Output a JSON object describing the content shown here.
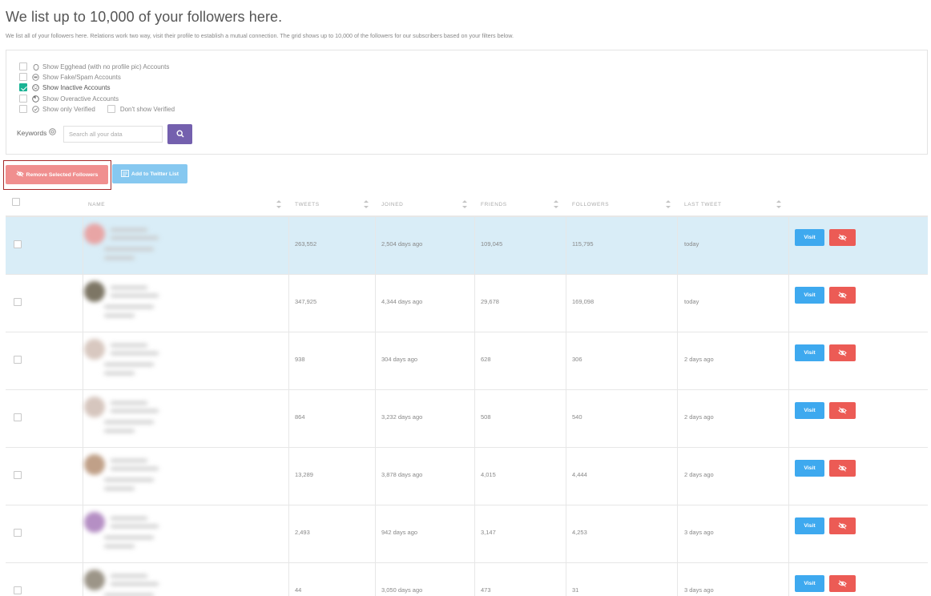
{
  "header": {
    "title": "We list up to 10,000 of your followers here.",
    "description": "We list all of your followers here. Relations work two way, visit their profile to establish a mutual connection. The grid shows up to 10,000 of the followers for our subscribers based on your filters below."
  },
  "filters": {
    "egghead": {
      "label": "Show Egghead (with no profile pic) Accounts",
      "checked": false,
      "icon": "egg-icon"
    },
    "fake": {
      "label": "Show Fake/Spam Accounts",
      "checked": false,
      "icon": "robot-icon"
    },
    "inactive": {
      "label": "Show Inactive Accounts",
      "checked": true,
      "icon": "sleep-face-icon"
    },
    "overactive": {
      "label": "Show Overactive Accounts",
      "checked": false,
      "icon": "speedometer-icon"
    },
    "verified_only": {
      "label": "Show only Verified",
      "checked": false,
      "icon": "verified-icon"
    },
    "hide_verified": {
      "label": "Don't show Verified",
      "checked": false
    }
  },
  "search": {
    "label": "Keywords",
    "placeholder": "Search all your data",
    "button_icon": "search-icon"
  },
  "actions": {
    "remove_label": "Remove Selected Followers",
    "add_list_label": "Add to Twitter List"
  },
  "grid": {
    "columns": [
      "NAME",
      "TWEETS",
      "JOINED",
      "FRIENDS",
      "FOLLOWERS",
      "LAST TWEET"
    ],
    "visit_label": "Visit",
    "rows": [
      {
        "tweets": "263,552",
        "joined": "2,504 days ago",
        "friends": "109,045",
        "followers": "115,795",
        "last_tweet": "today",
        "selected": true,
        "avatar_color": "#e8a5a5"
      },
      {
        "tweets": "347,925",
        "joined": "4,344 days ago",
        "friends": "29,678",
        "followers": "169,098",
        "last_tweet": "today",
        "selected": false,
        "avatar_color": "#7d7665"
      },
      {
        "tweets": "938",
        "joined": "304 days ago",
        "friends": "628",
        "followers": "306",
        "last_tweet": "2 days ago",
        "selected": false,
        "avatar_color": "#d8c8c0"
      },
      {
        "tweets": "864",
        "joined": "3,232 days ago",
        "friends": "508",
        "followers": "540",
        "last_tweet": "2 days ago",
        "selected": false,
        "avatar_color": "#d6c6be"
      },
      {
        "tweets": "13,289",
        "joined": "3,878 days ago",
        "friends": "4,015",
        "followers": "4,444",
        "last_tweet": "2 days ago",
        "selected": false,
        "avatar_color": "#c0a088"
      },
      {
        "tweets": "2,493",
        "joined": "942 days ago",
        "friends": "3,147",
        "followers": "4,253",
        "last_tweet": "3 days ago",
        "selected": false,
        "avatar_color": "#b58fc4"
      },
      {
        "tweets": "44",
        "joined": "3,050 days ago",
        "friends": "473",
        "followers": "31",
        "last_tweet": "3 days ago",
        "selected": false,
        "avatar_color": "#9c9588"
      }
    ]
  },
  "colors": {
    "checked": "#1ab394",
    "search_button": "#7460ae",
    "remove_button": "#f08f8f",
    "add_list_button": "#86c8f0",
    "visit_button": "#3ea9ef",
    "hide_button": "#ec5b55",
    "selected_row": "#d9edf7"
  }
}
